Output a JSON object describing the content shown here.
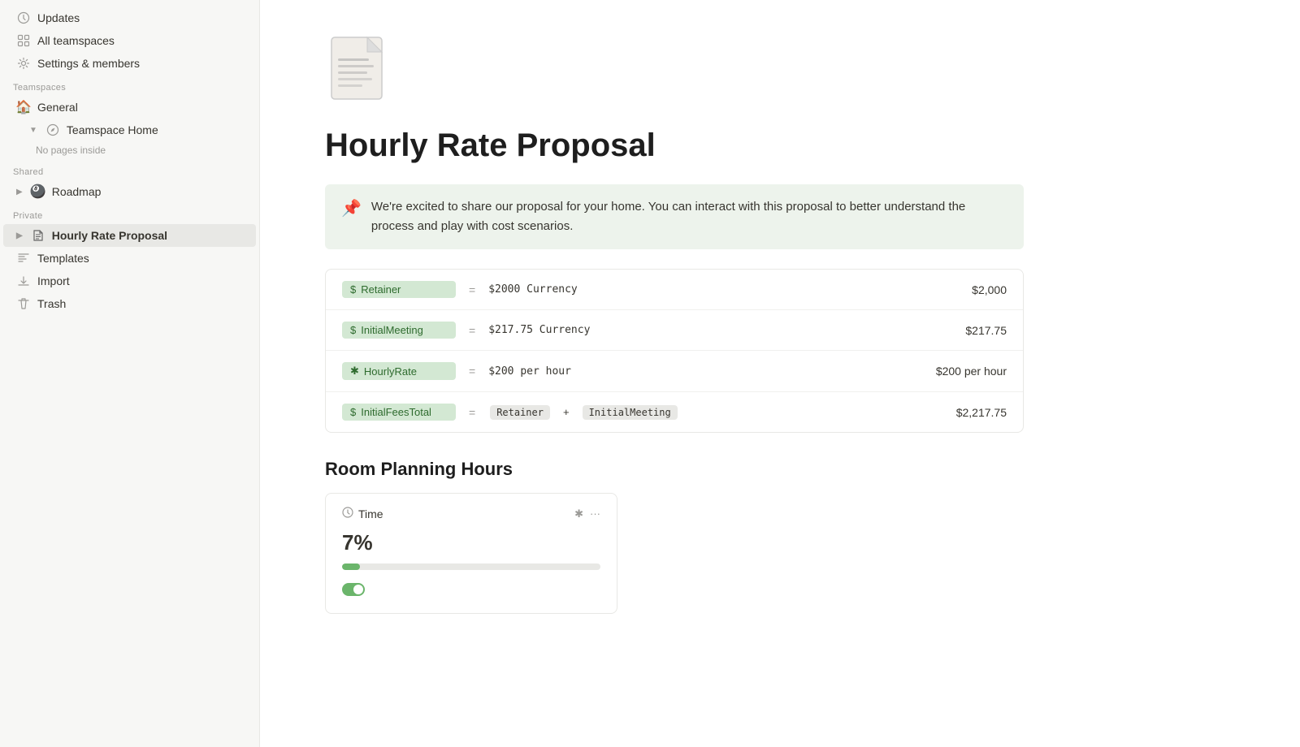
{
  "sidebar": {
    "updates_label": "Updates",
    "all_teamspaces_label": "All teamspaces",
    "settings_label": "Settings & members",
    "teamspaces_section": "Teamspaces",
    "general_label": "General",
    "teamspace_home_label": "Teamspace Home",
    "no_pages_label": "No pages inside",
    "shared_section": "Shared",
    "roadmap_label": "Roadmap",
    "private_section": "Private",
    "hourly_rate_label": "Hourly Rate Proposal",
    "templates_label": "Templates",
    "import_label": "Import",
    "trash_label": "Trash"
  },
  "page": {
    "title": "Hourly Rate Proposal",
    "callout": "We're excited to share our proposal for your home. You can interact with this proposal to better understand the process and play with cost scenarios.",
    "callout_icon": "📌",
    "formula_rows": [
      {
        "icon": "$",
        "tag": "Retainer",
        "equals": "=",
        "value": "$2000 Currency",
        "result": "$2,000"
      },
      {
        "icon": "$",
        "tag": "InitialMeeting",
        "equals": "=",
        "value": "$217.75 Currency",
        "result": "$217.75"
      },
      {
        "icon": "✱",
        "tag": "HourlyRate",
        "equals": "=",
        "value": "$200 per hour",
        "result": "$200 per hour",
        "asterisk": true
      },
      {
        "icon": "$",
        "tag": "InitialFeesTotal",
        "equals": "=",
        "chips": [
          "Retainer",
          "+",
          "InitialMeeting"
        ],
        "result": "$2,217.75"
      }
    ],
    "room_planning_heading": "Room Planning Hours",
    "time_card": {
      "label": "Time",
      "asterisk": "✱",
      "more": "···",
      "value": "7%",
      "progress_pct": 7
    }
  }
}
